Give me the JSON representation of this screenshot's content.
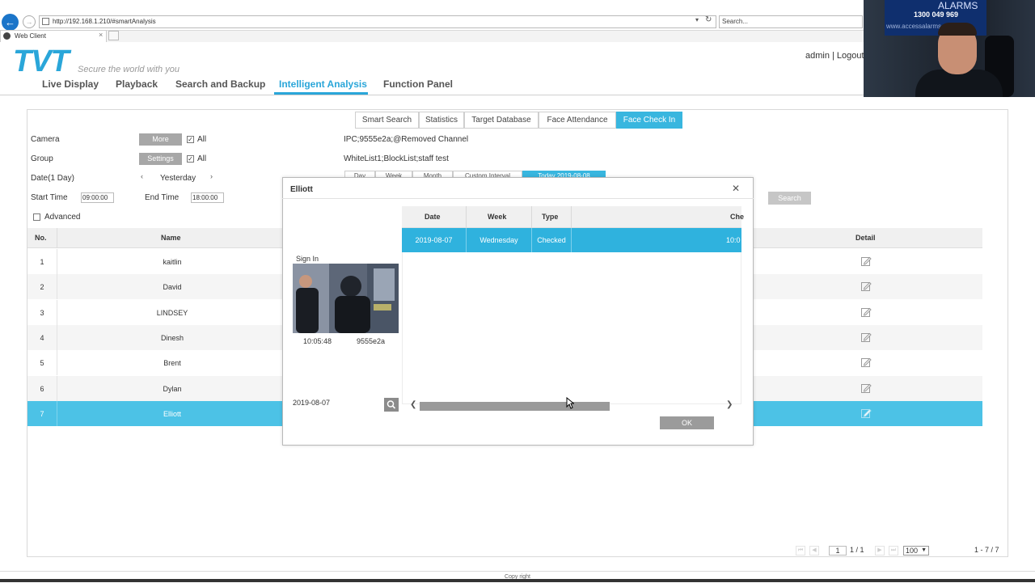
{
  "browser": {
    "url": "http://192.168.1.210/#smartAnalysis",
    "search_placeholder": "Search...",
    "tab_title": "Web Client"
  },
  "webcam": {
    "phone": "1300 049 969",
    "brand": "ALARMS",
    "url": "www.accessalarms.com.au"
  },
  "header": {
    "logo": "TVT",
    "tagline": "Secure the world with you",
    "user": "admin | Logout",
    "nav": [
      "Live Display",
      "Playback",
      "Search and Backup",
      "Intelligent Analysis",
      "Function Panel"
    ],
    "active_nav": "Intelligent Analysis"
  },
  "subtabs": [
    "Smart Search",
    "Statistics",
    "Target Database",
    "Face Attendance",
    "Face Check In"
  ],
  "active_subtab": "Face Check In",
  "filters": {
    "camera_label": "Camera",
    "camera_button": "More",
    "camera_all": "All",
    "camera_value": "IPC;9555e2a;@Removed Channel",
    "group_label": "Group",
    "group_button": "Settings",
    "group_all": "All",
    "group_value": "WhiteList1;BlockList;staff test",
    "date_label": "Date(1 Day)",
    "date_value": "Yesterday",
    "start_label": "Start Time",
    "start_value": "09:00:00",
    "end_label": "End Time",
    "end_value": "18:00:00",
    "advanced_label": "Advanced",
    "quick_tabs": [
      "Day",
      "Week",
      "Month",
      "Custom Interval",
      "Today 2019-08-08"
    ],
    "search_button": "Search"
  },
  "table": {
    "headers": {
      "no": "No.",
      "name": "Name",
      "detail": "Detail"
    },
    "rows": [
      {
        "no": "1",
        "name": "kaitlin"
      },
      {
        "no": "2",
        "name": "David"
      },
      {
        "no": "3",
        "name": "LINDSEY"
      },
      {
        "no": "4",
        "name": "Dinesh"
      },
      {
        "no": "5",
        "name": "Brent"
      },
      {
        "no": "6",
        "name": "Dylan"
      },
      {
        "no": "7",
        "name": "Elliott"
      }
    ],
    "selected_row": 7,
    "edit_icon": "edit-icon"
  },
  "pagination": {
    "page_input": "1",
    "page_info": "1 / 1",
    "page_size": "100",
    "range": "1 - 7 / 7"
  },
  "footer": "Copy right",
  "modal": {
    "title": "Elliott",
    "sign_in_label": "Sign In",
    "snapshot_time": "10:05:48",
    "snapshot_channel": "9555e2a",
    "date_value": "2019-08-07",
    "columns": [
      "Date",
      "Week",
      "Type",
      "Che"
    ],
    "rows": [
      {
        "date": "2019-08-07",
        "week": "Wednesday",
        "type": "Checked",
        "check": "10:0"
      }
    ],
    "ok_button": "OK"
  },
  "colors": {
    "accent": "#38b6df",
    "selected_row": "#4cc2e6",
    "logo": "#2aa6d9"
  }
}
